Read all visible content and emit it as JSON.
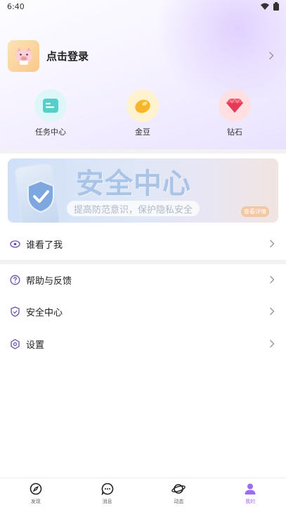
{
  "status_bar": {
    "time": "6:40"
  },
  "profile": {
    "login_label": "点击登录"
  },
  "assets": [
    {
      "label": "任务中心",
      "icon": "task-center-icon",
      "bg": "#dff6f8"
    },
    {
      "label": "金豆",
      "icon": "gold-bean-icon",
      "bg": "#fff3cf"
    },
    {
      "label": "钻石",
      "icon": "diamond-icon",
      "bg": "#ffe0e2"
    }
  ],
  "banner": {
    "title": "安全中心",
    "subtitle": "提高防范意识，保护隐私安全",
    "button": "查看详情"
  },
  "menu": {
    "who_viewed": "谁看了我",
    "help_feedback": "帮助与反馈",
    "security_center": "安全中心",
    "settings": "设置"
  },
  "tabbar": [
    {
      "label": "发现",
      "icon": "compass-icon"
    },
    {
      "label": "消息",
      "icon": "chat-bubble-icon"
    },
    {
      "label": "动态",
      "icon": "planet-icon"
    },
    {
      "label": "我的",
      "icon": "person-icon",
      "active": true
    }
  ],
  "colors": {
    "accent": "#9c6cf2",
    "row_icon": "#6b4ea8"
  }
}
